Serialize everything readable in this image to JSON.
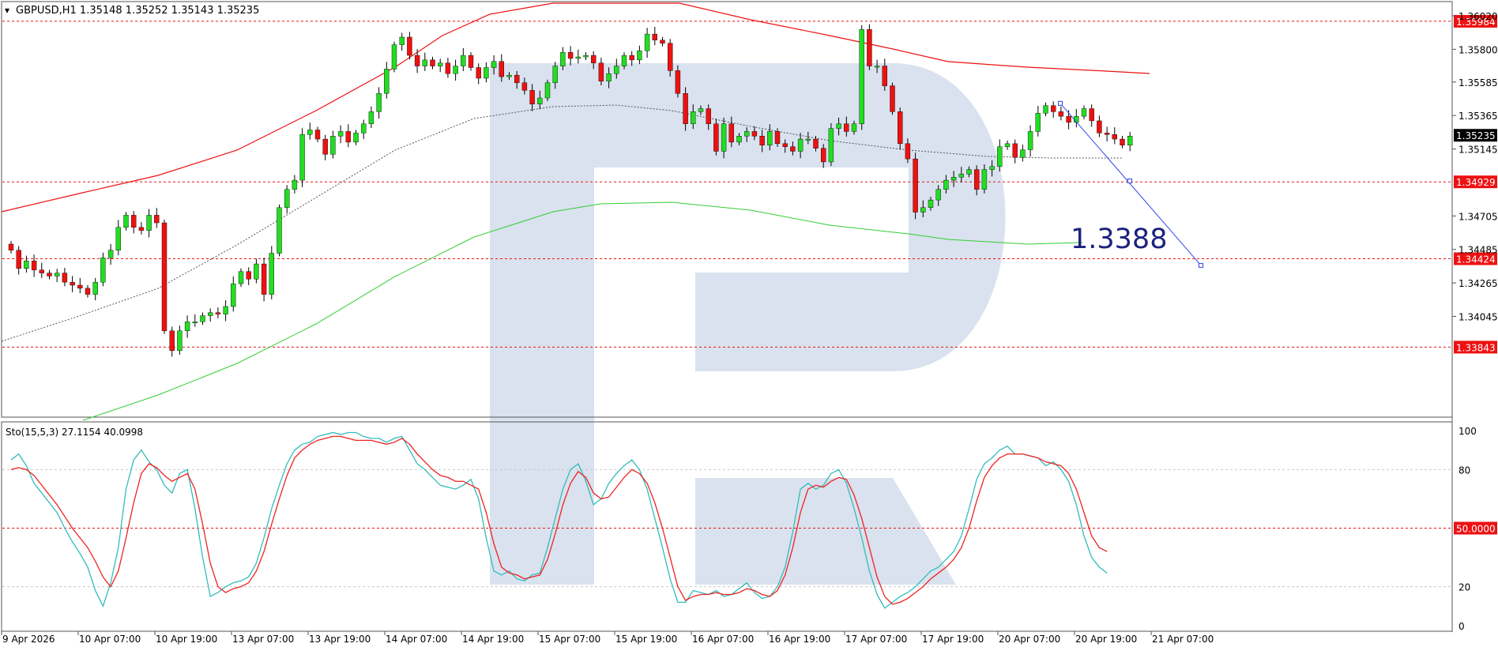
{
  "header": {
    "symbol": "GBPUSD,H1",
    "ohlc": "1.35148 1.35252 1.35143 1.35235"
  },
  "stoch_header": "Sto(15,5,3) 27.1154 40.0998",
  "target_label": "1.3388",
  "colors": {
    "bull": "#22dd22",
    "bear": "#ee1111",
    "ma_red": "#ee1111",
    "ma_green": "#33cc33",
    "ma_dotted": "#555555",
    "level": "#ee1111",
    "target_line": "#3344ee",
    "target_text": "#1a237e",
    "stoch_main": "#33bbbb",
    "stoch_signal": "#ee2222",
    "grid": "#c8c8c8",
    "watermark": "#d9e2ee"
  },
  "chart_data": [
    {
      "type": "candlestick",
      "title": "GBPUSD,H1",
      "ylim": [
        1.3374,
        1.3606
      ],
      "price_axis_ticks": [
        "1.36020",
        "1.35800",
        "1.35585",
        "1.35365",
        "1.35145",
        "1.34705",
        "1.34485",
        "1.34265",
        "1.34045"
      ],
      "price_axis_tick_values": [
        1.3602,
        1.358,
        1.35585,
        1.35365,
        1.35145,
        1.34705,
        1.34485,
        1.34265,
        1.34045
      ],
      "horizontal_levels": [
        {
          "value": 1.35984,
          "label": "1.35984"
        },
        {
          "value": 1.34929,
          "label": "1.34929"
        },
        {
          "value": 1.34424,
          "label": "1.34424"
        },
        {
          "value": 1.33843,
          "label": "1.33843"
        }
      ],
      "current_price": {
        "value": 1.35235,
        "label": "1.35235"
      },
      "time_axis_labels": [
        "9 Apr 2026",
        "10 Apr 07:00",
        "10 Apr 19:00",
        "13 Apr 07:00",
        "13 Apr 19:00",
        "14 Apr 07:00",
        "14 Apr 19:00",
        "15 Apr 07:00",
        "15 Apr 19:00",
        "16 Apr 07:00",
        "16 Apr 19:00",
        "17 Apr 07:00",
        "17 Apr 19:00",
        "20 Apr 07:00",
        "20 Apr 19:00",
        "21 Apr 07:00"
      ],
      "forecast": {
        "from_value": 1.35445,
        "to_value": 1.3438,
        "label": "1.3388"
      },
      "closes": [
        1.3448,
        1.3436,
        1.3441,
        1.3435,
        1.3433,
        1.3431,
        1.3433,
        1.3427,
        1.3425,
        1.3423,
        1.3419,
        1.3427,
        1.3443,
        1.3448,
        1.3463,
        1.3471,
        1.3463,
        1.3461,
        1.3471,
        1.3466,
        1.3395,
        1.3382,
        1.3395,
        1.3401,
        1.3401,
        1.3405,
        1.3407,
        1.3406,
        1.3411,
        1.3426,
        1.3434,
        1.3429,
        1.3439,
        1.3419,
        1.3446,
        1.3476,
        1.3488,
        1.3494,
        1.3524,
        1.3527,
        1.3521,
        1.3511,
        1.3523,
        1.3526,
        1.3519,
        1.3525,
        1.3531,
        1.3539,
        1.3551,
        1.3567,
        1.3583,
        1.3588,
        1.3576,
        1.3569,
        1.3573,
        1.3569,
        1.3571,
        1.3564,
        1.3569,
        1.3576,
        1.3568,
        1.3561,
        1.3568,
        1.3572,
        1.3562,
        1.3563,
        1.3558,
        1.3553,
        1.3544,
        1.3548,
        1.3558,
        1.3569,
        1.3578,
        1.3574,
        1.3575,
        1.3576,
        1.3571,
        1.3559,
        1.3564,
        1.3569,
        1.3576,
        1.3573,
        1.3579,
        1.359,
        1.3586,
        1.3584,
        1.3566,
        1.3551,
        1.3531,
        1.3539,
        1.3541,
        1.3531,
        1.3513,
        1.3531,
        1.3519,
        1.3523,
        1.3526,
        1.3523,
        1.3517,
        1.3526,
        1.3518,
        1.3516,
        1.3513,
        1.3521,
        1.3521,
        1.3515,
        1.3506,
        1.3528,
        1.3531,
        1.3526,
        1.3531,
        1.3593,
        1.3569,
        1.3569,
        1.3556,
        1.3539,
        1.3518,
        1.3508,
        1.3473,
        1.3476,
        1.3481,
        1.3488,
        1.3494,
        1.3496,
        1.3498,
        1.3501,
        1.3488,
        1.3501,
        1.3503,
        1.3516,
        1.3518,
        1.3509,
        1.3514,
        1.3526,
        1.3538,
        1.3543,
        1.3539,
        1.3536,
        1.3532,
        1.3536,
        1.3541,
        1.3533,
        1.3525,
        1.3524,
        1.3521,
        1.3517,
        1.3523
      ]
    },
    {
      "type": "line",
      "title": "Sto(15,5,3) 27.1154 40.0998",
      "ylim": [
        0,
        100
      ],
      "y_ticks": [
        "100",
        "80",
        "50.0000",
        "20",
        "0"
      ],
      "y_tick_values": [
        100,
        80,
        50,
        20,
        0
      ],
      "levels": [
        80,
        50,
        20
      ],
      "series": [
        {
          "values": [
            85,
            88,
            82,
            73,
            68,
            63,
            58,
            50,
            43,
            37,
            30,
            18,
            10,
            22,
            40,
            70,
            85,
            90,
            84,
            80,
            72,
            68,
            78,
            80,
            60,
            35,
            15,
            17,
            20,
            22,
            23,
            25,
            32,
            45,
            60,
            72,
            83,
            90,
            93,
            94,
            97,
            98,
            99,
            98,
            99,
            99,
            97,
            96,
            96,
            94,
            96,
            97,
            90,
            83,
            80,
            76,
            72,
            71,
            70,
            72,
            75,
            65,
            45,
            28,
            26,
            28,
            24,
            23,
            26,
            27,
            40,
            55,
            70,
            80,
            83,
            74,
            62,
            65,
            73,
            78,
            82,
            85,
            80,
            70,
            55,
            40,
            24,
            12,
            12,
            18,
            17,
            16,
            18,
            15,
            16,
            19,
            22,
            17,
            14,
            15,
            20,
            30,
            48,
            70,
            73,
            70,
            72,
            78,
            80,
            73,
            60,
            45,
            28,
            16,
            9,
            12,
            15,
            17,
            20,
            24,
            28,
            30,
            34,
            38,
            46,
            60,
            75,
            83,
            86,
            90,
            92,
            88,
            88,
            87,
            86,
            82,
            84,
            80,
            74,
            62,
            46,
            35,
            30,
            27
          ]
        },
        {
          "values": [
            80,
            81,
            80,
            77,
            72,
            67,
            62,
            56,
            50,
            45,
            40,
            33,
            25,
            20,
            28,
            45,
            63,
            78,
            83,
            81,
            77,
            74,
            76,
            78,
            70,
            52,
            32,
            20,
            17,
            19,
            20,
            22,
            28,
            38,
            52,
            65,
            77,
            86,
            90,
            93,
            95,
            96,
            97,
            97,
            96,
            95,
            95,
            95,
            94,
            93,
            94,
            96,
            93,
            88,
            84,
            80,
            77,
            76,
            74,
            74,
            72,
            70,
            58,
            42,
            30,
            27,
            26,
            24,
            25,
            26,
            34,
            47,
            62,
            73,
            79,
            76,
            68,
            65,
            66,
            71,
            76,
            80,
            78,
            73,
            63,
            50,
            35,
            20,
            13,
            15,
            16,
            16,
            17,
            16,
            16,
            17,
            19,
            18,
            16,
            15,
            18,
            26,
            40,
            58,
            70,
            72,
            71,
            74,
            76,
            75,
            67,
            55,
            40,
            25,
            15,
            11,
            12,
            14,
            17,
            20,
            24,
            27,
            30,
            34,
            40,
            50,
            64,
            76,
            82,
            86,
            88,
            88,
            88,
            87,
            86,
            84,
            83,
            82,
            78,
            70,
            58,
            46,
            40,
            38
          ]
        }
      ]
    }
  ]
}
